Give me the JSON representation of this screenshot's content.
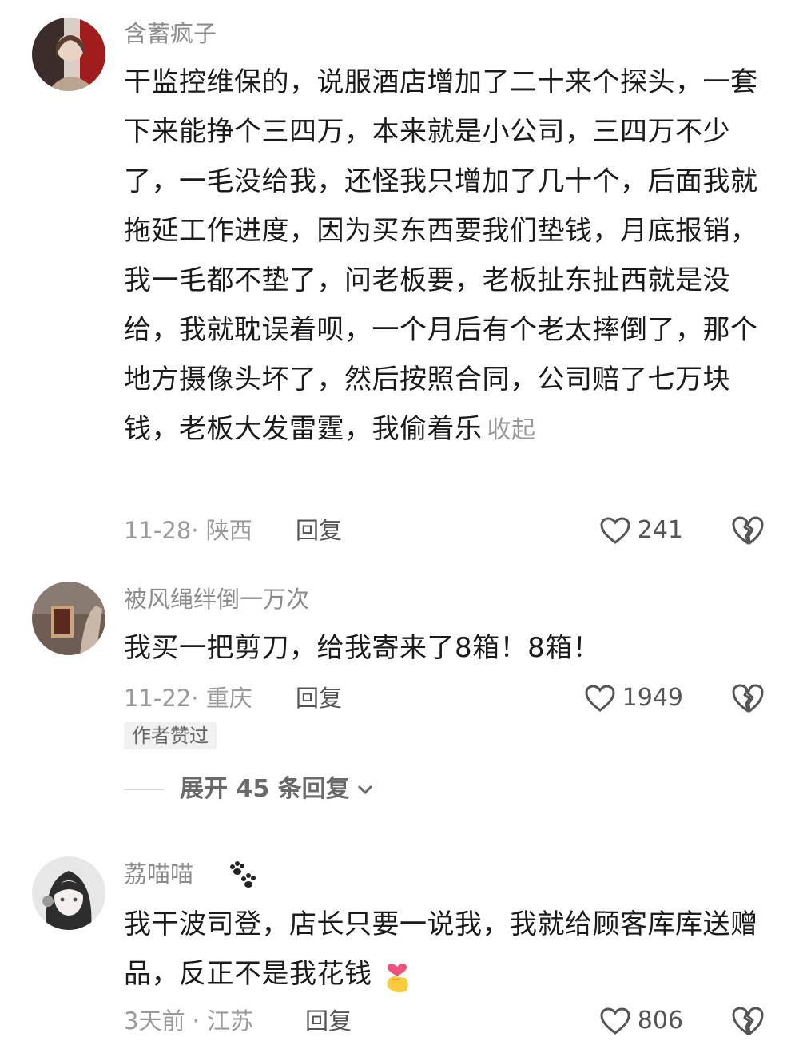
{
  "comments": [
    {
      "username": "含蓄疯子",
      "text": "干监控维保的，说服酒店增加了二十来个探头，一套下来能挣个三四万，本来就是小公司，三四万不少了，一毛没给我，还怪我只增加了几十个，后面我就拖延工作进度，因为买东西要我们垫钱，月底报销，我一毛都不垫了，问老板要，老板扯东扯西就是没给，我就耽误着呗，一个月后有个老太摔倒了，那个地方摄像头坏了，然后按照合同，公司赔了七万块钱，老板大发雷霆，我偷着乐",
      "collapse_label": "收起",
      "meta": "11-28· 陕西",
      "reply_label": "回复",
      "likes": "241"
    },
    {
      "username": "被风绳绊倒一万次",
      "text": "我买一把剪刀，给我寄来了8箱！8箱！",
      "meta": "11-22· 重庆",
      "reply_label": "回复",
      "likes": "1949",
      "badge": "作者赞过",
      "expand_label": "展开 45 条回复"
    },
    {
      "username": "荔喵喵",
      "text": "我干波司登，店长只要一说我，我就给顾客库库送赠品，反正不是我花钱",
      "meta": "3天前 · 江苏",
      "reply_label": "回复",
      "likes": "806"
    }
  ],
  "icons": {
    "like": "heart-outline-icon",
    "dislike": "broken-heart-icon",
    "expand": "chevron-down-icon",
    "paw": "paw-print-icon",
    "emoji": "finger-heart-emoji"
  }
}
